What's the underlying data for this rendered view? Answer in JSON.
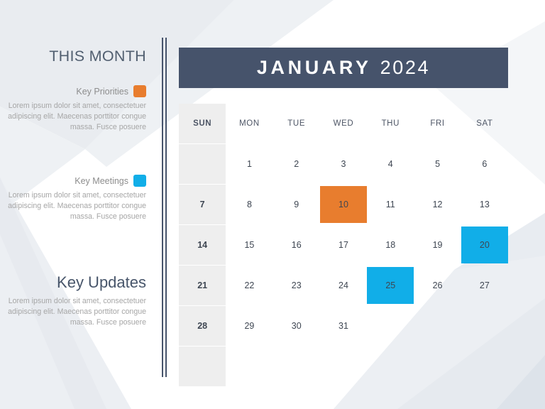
{
  "theme": {
    "navy": "#46536b",
    "orange": "#e87d2e",
    "blue": "#11aee8",
    "cell_gray": "#eeeeee",
    "body_gray": "#a6a6a6"
  },
  "sidebar": {
    "title": "THIS MONTH",
    "blocks": [
      {
        "label": "Key Priorities",
        "swatch_color": "#e87d2e",
        "swatch_name": "orange-swatch",
        "body": "Lorem ipsum dolor sit amet, consectetuer adipiscing elit. Maecenas porttitor congue massa. Fusce posuere"
      },
      {
        "label": "Key Meetings",
        "swatch_color": "#11aee8",
        "swatch_name": "blue-swatch",
        "body": "Lorem ipsum dolor sit amet, consectetuer adipiscing elit. Maecenas porttitor congue massa. Fusce posuere"
      }
    ],
    "updates": {
      "title": "Key Updates",
      "body": "Lorem ipsum dolor sit amet, consectetuer adipiscing elit. Maecenas porttitor congue massa. Fusce posuere"
    }
  },
  "calendar": {
    "month": "JANUARY",
    "year": "2024",
    "weekdays": [
      "SUN",
      "MON",
      "TUE",
      "WED",
      "THU",
      "FRI",
      "SAT"
    ],
    "weeks": [
      [
        {
          "day": ""
        },
        {
          "day": "1"
        },
        {
          "day": "2"
        },
        {
          "day": "3"
        },
        {
          "day": "4"
        },
        {
          "day": "5"
        },
        {
          "day": "6"
        }
      ],
      [
        {
          "day": "7"
        },
        {
          "day": "8"
        },
        {
          "day": "9"
        },
        {
          "day": "10",
          "highlight": "orange"
        },
        {
          "day": "11"
        },
        {
          "day": "12"
        },
        {
          "day": "13"
        }
      ],
      [
        {
          "day": "14"
        },
        {
          "day": "15"
        },
        {
          "day": "16"
        },
        {
          "day": "17"
        },
        {
          "day": "18"
        },
        {
          "day": "19"
        },
        {
          "day": "20",
          "highlight": "blue"
        }
      ],
      [
        {
          "day": "21"
        },
        {
          "day": "22"
        },
        {
          "day": "23"
        },
        {
          "day": "24"
        },
        {
          "day": "25",
          "highlight": "blue"
        },
        {
          "day": "26"
        },
        {
          "day": "27"
        }
      ],
      [
        {
          "day": "28"
        },
        {
          "day": "29"
        },
        {
          "day": "30"
        },
        {
          "day": "31"
        },
        {
          "day": ""
        },
        {
          "day": ""
        },
        {
          "day": ""
        }
      ],
      [
        {
          "day": ""
        },
        {
          "day": ""
        },
        {
          "day": ""
        },
        {
          "day": ""
        },
        {
          "day": ""
        },
        {
          "day": ""
        },
        {
          "day": ""
        }
      ]
    ]
  }
}
